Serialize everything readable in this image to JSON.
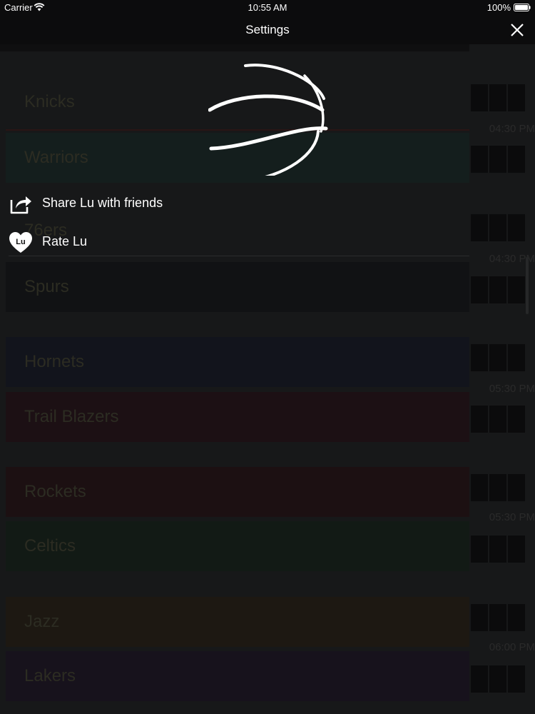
{
  "status_bar": {
    "carrier": "Carrier",
    "time": "10:55 AM",
    "battery": "100%"
  },
  "nav": {
    "title": "Settings",
    "close_label": "X"
  },
  "settings": {
    "items": [
      {
        "label": "Share Lu with friends",
        "icon": "share-icon"
      },
      {
        "label": "Rate Lu",
        "icon": "heart-icon",
        "icon_text": "Lu"
      }
    ]
  },
  "background_games": [
    {
      "home": {
        "name": "Knicks",
        "color": "#171819"
      },
      "away": {
        "name": "Warriors",
        "color": "#141e1d"
      },
      "time": "04:30 PM"
    },
    {
      "home": {
        "name": "76ers",
        "color": "#171819"
      },
      "away": {
        "name": "Spurs",
        "color": "#111214"
      },
      "time": "04:30 PM"
    },
    {
      "home": {
        "name": "Hornets",
        "color": "#12141c"
      },
      "away": {
        "name": "Trail Blazers",
        "color": "#1c1014"
      },
      "time": "05:30 PM"
    },
    {
      "home": {
        "name": "Rockets",
        "color": "#1c1012"
      },
      "away": {
        "name": "Celtics",
        "color": "#121a15"
      },
      "time": "05:30 PM"
    },
    {
      "home": {
        "name": "Jazz",
        "color": "#1d1812"
      },
      "away": {
        "name": "Lakers",
        "color": "#17121c"
      },
      "time": "06:00 PM"
    }
  ],
  "colors": {
    "overlay_text": "#ffffff",
    "nav_background": "#0c0c0d",
    "page_background": "#171819"
  }
}
